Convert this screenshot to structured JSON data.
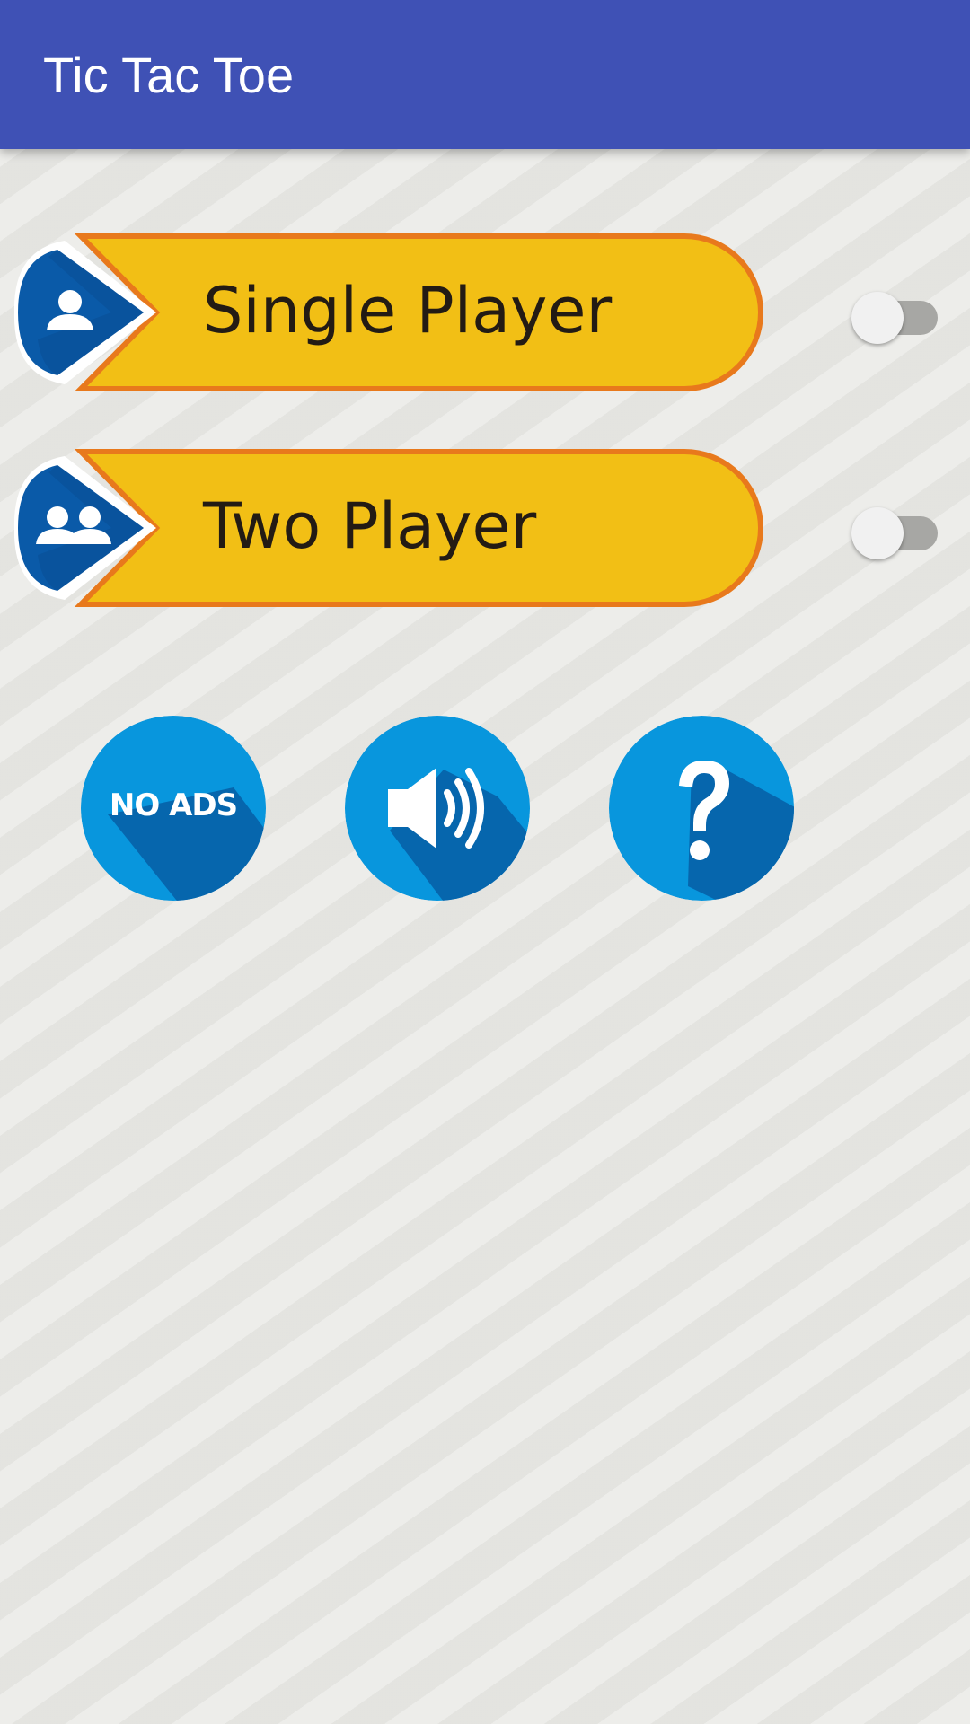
{
  "app_bar": {
    "title": "Tic Tac Toe",
    "color": "#3f51b5"
  },
  "modes": [
    {
      "label": "Single Player",
      "icon": "single-user-icon",
      "toggle_on": false
    },
    {
      "label": "Two Player",
      "icon": "two-users-icon",
      "toggle_on": false
    }
  ],
  "actions": [
    {
      "label": "NO ADS",
      "icon": "no-ads-icon"
    },
    {
      "icon": "speaker-icon"
    },
    {
      "icon": "question-mark-icon"
    }
  ],
  "colors": {
    "mode_fill": "#f2bf15",
    "mode_border": "#e8791c",
    "badge_blue": "#0a5aa8",
    "action_blue": "#0896dd",
    "action_shadow": "#0666ad"
  }
}
